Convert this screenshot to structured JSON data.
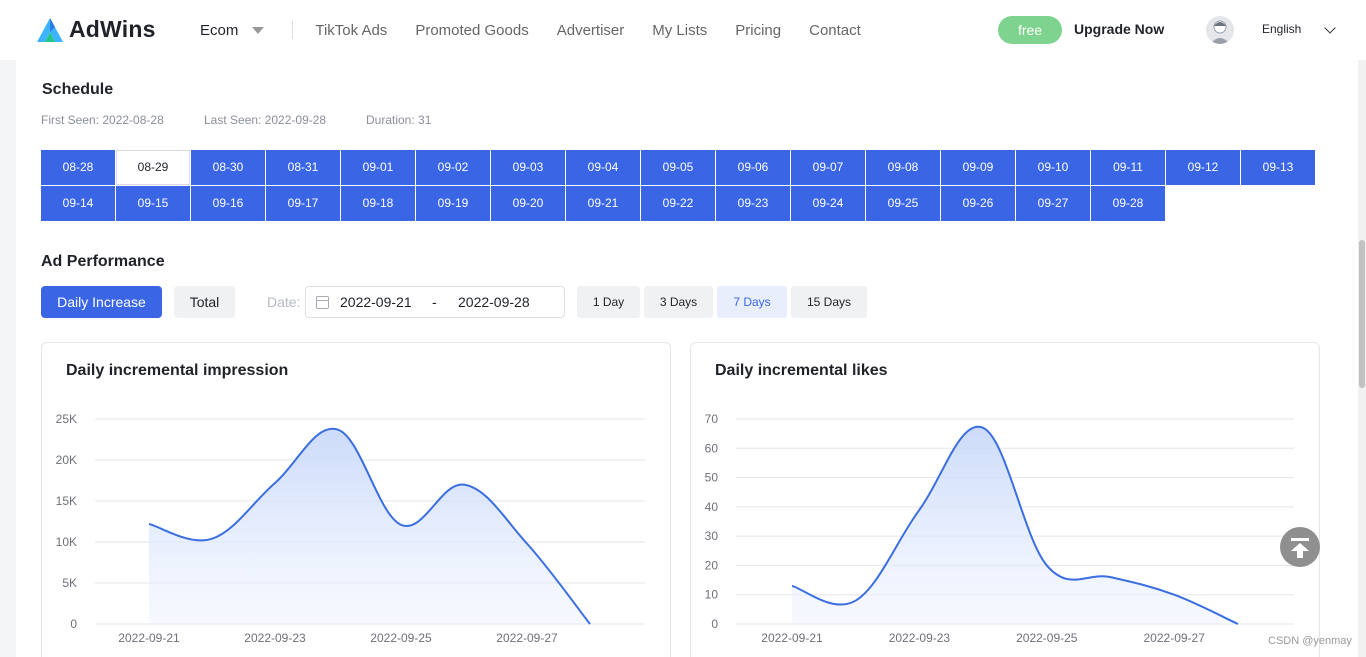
{
  "header": {
    "brand": "AdWins",
    "nav": [
      "TikTok Ads",
      "Promoted Goods",
      "Advertiser",
      "My Lists",
      "Pricing",
      "Contact"
    ],
    "ecom_label": "Ecom",
    "plan_badge": "free",
    "upgrade_label": "Upgrade Now",
    "language": "English"
  },
  "schedule": {
    "title": "Schedule",
    "first_seen": "First Seen: 2022-08-28",
    "last_seen": "Last Seen: 2022-09-28",
    "duration": "Duration: 31",
    "dates": [
      {
        "label": "08-28",
        "active": true
      },
      {
        "label": "08-29",
        "active": false
      },
      {
        "label": "08-30",
        "active": true
      },
      {
        "label": "08-31",
        "active": true
      },
      {
        "label": "09-01",
        "active": true
      },
      {
        "label": "09-02",
        "active": true
      },
      {
        "label": "09-03",
        "active": true
      },
      {
        "label": "09-04",
        "active": true
      },
      {
        "label": "09-05",
        "active": true
      },
      {
        "label": "09-06",
        "active": true
      },
      {
        "label": "09-07",
        "active": true
      },
      {
        "label": "09-08",
        "active": true
      },
      {
        "label": "09-09",
        "active": true
      },
      {
        "label": "09-10",
        "active": true
      },
      {
        "label": "09-11",
        "active": true
      },
      {
        "label": "09-12",
        "active": true
      },
      {
        "label": "09-13",
        "active": true
      },
      {
        "label": "09-14",
        "active": true
      },
      {
        "label": "09-15",
        "active": true
      },
      {
        "label": "09-16",
        "active": true
      },
      {
        "label": "09-17",
        "active": true
      },
      {
        "label": "09-18",
        "active": true
      },
      {
        "label": "09-19",
        "active": true
      },
      {
        "label": "09-20",
        "active": true
      },
      {
        "label": "09-21",
        "active": true
      },
      {
        "label": "09-22",
        "active": true
      },
      {
        "label": "09-23",
        "active": true
      },
      {
        "label": "09-24",
        "active": true
      },
      {
        "label": "09-25",
        "active": true
      },
      {
        "label": "09-26",
        "active": true
      },
      {
        "label": "09-27",
        "active": true
      },
      {
        "label": "09-28",
        "active": true
      }
    ]
  },
  "performance": {
    "title": "Ad Performance",
    "daily_increase_label": "Daily Increase",
    "total_label": "Total",
    "date_label": "Date:",
    "range_start": "2022-09-21",
    "range_separator": "-",
    "range_end": "2022-09-28",
    "range_options": [
      "1 Day",
      "3 Days",
      "7 Days",
      "15 Days"
    ],
    "selected_range": "7 Days"
  },
  "colors": {
    "accent": "#3a66e6",
    "line": "#3b6ee0",
    "free_badge": "#7ed48e"
  },
  "watermark": "CSDN @yenmay",
  "chart_data": [
    {
      "type": "area",
      "title": "Daily incremental impression",
      "x": [
        "2022-09-21",
        "2022-09-22",
        "2022-09-23",
        "2022-09-24",
        "2022-09-25",
        "2022-09-26",
        "2022-09-27",
        "2022-09-28"
      ],
      "x_tick_labels": [
        "2022-09-21",
        "2022-09-23",
        "2022-09-25",
        "2022-09-27"
      ],
      "y_tick_labels": [
        "0",
        "5K",
        "10K",
        "15K",
        "20K",
        "25K"
      ],
      "values": [
        12200,
        10400,
        17200,
        23700,
        12100,
        17000,
        9800,
        0
      ],
      "ylim": [
        0,
        25000
      ],
      "grid": true
    },
    {
      "type": "area",
      "title": "Daily incremental likes",
      "x": [
        "2022-09-21",
        "2022-09-22",
        "2022-09-23",
        "2022-09-24",
        "2022-09-25",
        "2022-09-26",
        "2022-09-27",
        "2022-09-28"
      ],
      "x_tick_labels": [
        "2022-09-21",
        "2022-09-23",
        "2022-09-25",
        "2022-09-27"
      ],
      "y_tick_labels": [
        "0",
        "10",
        "20",
        "30",
        "40",
        "50",
        "60",
        "70"
      ],
      "values": [
        13,
        8,
        39,
        67,
        20,
        16,
        10,
        0
      ],
      "ylim": [
        0,
        70
      ],
      "grid": true
    }
  ]
}
